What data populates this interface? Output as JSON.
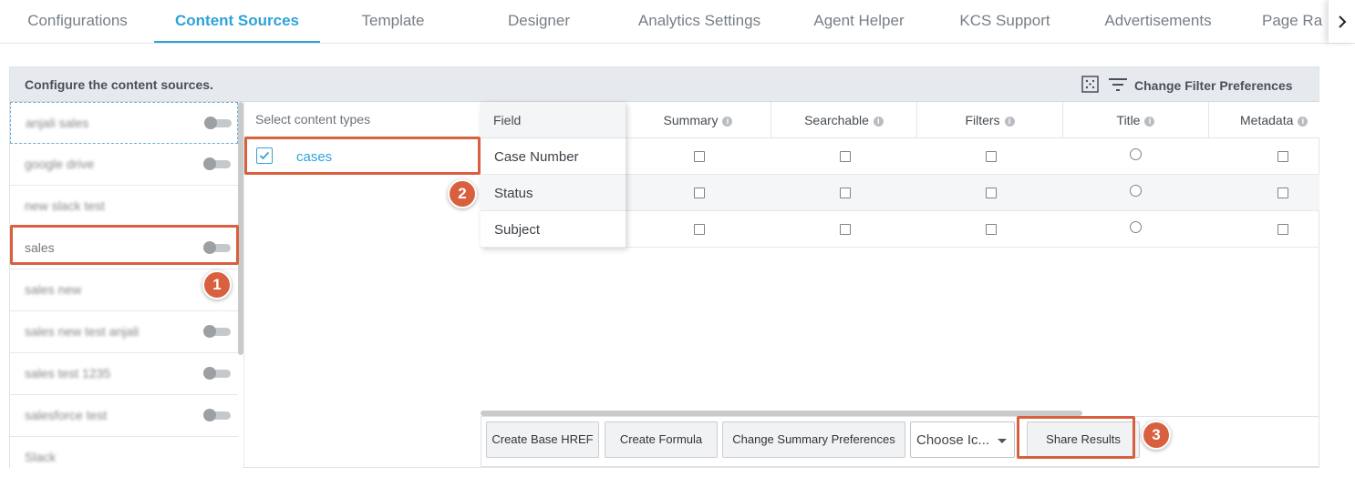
{
  "tabs": [
    {
      "label": "Configurations",
      "active": false
    },
    {
      "label": "Content Sources",
      "active": true
    },
    {
      "label": "Template",
      "active": false
    },
    {
      "label": "Designer",
      "active": false
    },
    {
      "label": "Analytics Settings",
      "active": false
    },
    {
      "label": "Agent Helper",
      "active": false
    },
    {
      "label": "KCS Support",
      "active": false
    },
    {
      "label": "Advertisements",
      "active": false
    },
    {
      "label": "Page Ra",
      "active": false
    }
  ],
  "panel": {
    "title": "Configure the content sources.",
    "filter_preferences": "Change Filter Preferences"
  },
  "sources": [
    {
      "label": "anjali sales",
      "blurred": true,
      "toggle": true
    },
    {
      "label": "google drive",
      "blurred": true,
      "toggle": true
    },
    {
      "label": "new slack test",
      "blurred": true,
      "toggle": false
    },
    {
      "label": "sales",
      "blurred": false,
      "toggle": true
    },
    {
      "label": "sales new",
      "blurred": true,
      "toggle": false
    },
    {
      "label": "sales new test anjali",
      "blurred": true,
      "toggle": true
    },
    {
      "label": "sales test 1235",
      "blurred": true,
      "toggle": true
    },
    {
      "label": "salesforce test",
      "blurred": true,
      "toggle": true
    },
    {
      "label": "Slack",
      "blurred": true,
      "toggle": false
    }
  ],
  "content_types": {
    "header": "Select content types",
    "items": [
      {
        "label": "cases",
        "checked": true
      }
    ]
  },
  "table": {
    "field_header": "Field",
    "columns": [
      "Summary",
      "Searchable",
      "Filters",
      "Title",
      "Metadata"
    ],
    "rows": [
      {
        "field": "Case Number"
      },
      {
        "field": "Status"
      },
      {
        "field": "Subject"
      }
    ]
  },
  "toolbar": {
    "create_base_href": "Create Base HREF",
    "create_formula": "Create Formula",
    "change_summary": "Change Summary Preferences",
    "choose_icon": "Choose Ic...",
    "share_results": "Share Results"
  },
  "annotations": [
    "1",
    "2",
    "3"
  ],
  "colors": {
    "accent": "#2fa3d8",
    "highlight": "#d8603f",
    "header_bg": "#e6eaee"
  }
}
